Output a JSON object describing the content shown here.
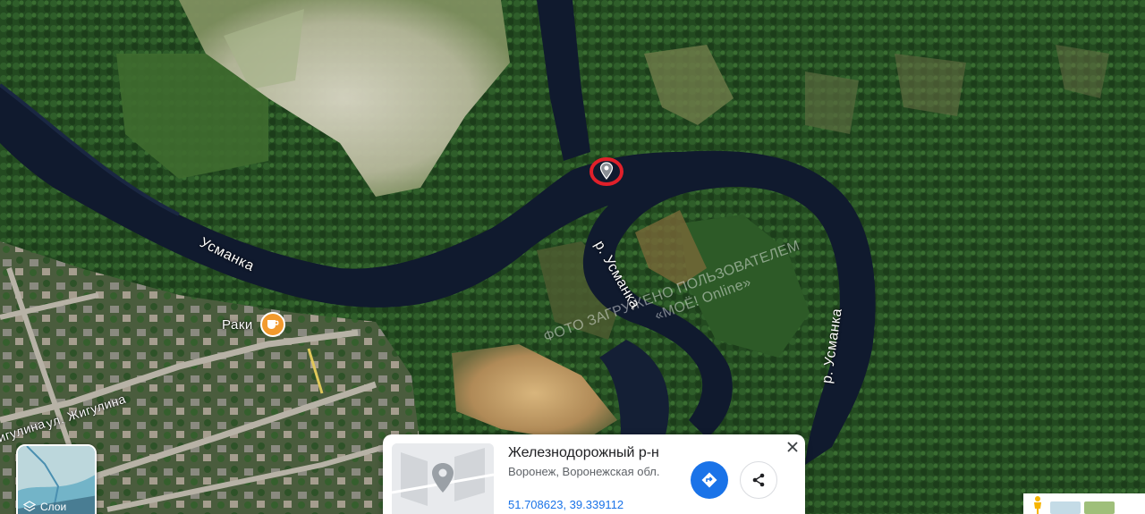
{
  "map": {
    "labels": {
      "river_main": "Усманка",
      "river_bend": "р. Усманка",
      "river_east": "р. Усманка",
      "street": "ул. Жигулина",
      "street_edge": "игулина"
    },
    "watermark": {
      "line1": "ФОТО ЗАГРУЖЕНО ПОЛЬЗОВАТЕЛЕМ",
      "line2": "«МОЁ! Online»"
    },
    "poi": {
      "name": "Раки",
      "icon": "cafe-icon",
      "color": "#f29a2e"
    },
    "marker_color": "#e0202a"
  },
  "layers": {
    "label": "Слои",
    "icon": "layers-icon"
  },
  "info_card": {
    "title": "Железнодорожный р-н",
    "subtitle": "Воронеж, Воронежская обл.",
    "coordinates": "51.708623, 39.339112",
    "directions_icon": "directions-icon",
    "share_icon": "share-icon",
    "close_icon": "close-icon",
    "accent": "#1a73e8"
  },
  "bottom_right": {
    "pegman_icon": "pegman-icon"
  }
}
